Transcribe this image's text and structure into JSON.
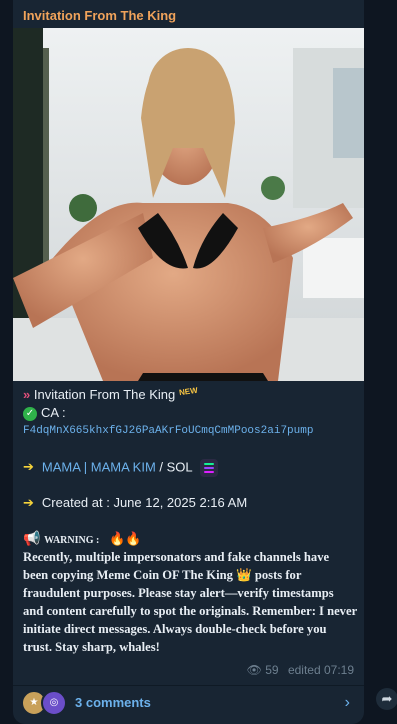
{
  "post": {
    "channel_title": "Invitation From The King",
    "headline_prefix": "»",
    "headline": "Invitation From The King",
    "new_badge": "NEW",
    "ca_label": "CA :",
    "ca_value": "F4dqMnX665khxfGJ26PaAKrFoUCmqCmMPoos2ai7pump",
    "arrow": "➔",
    "coin_link": "MAMA | MAMA KIM",
    "coin_sep": " / SOL",
    "created": "Created at : June 12, 2025 2:16 AM",
    "warning_label": "WARNING :",
    "warning_text": "Recently, multiple impersonators and fake channels have been copying Meme Coin OF The King 👑 posts for fraudulent purposes. Please stay alert—verify timestamps and content carefully to spot the originals. Remember: I never initiate direct messages. Always double-check before you trust. Stay sharp, whales!",
    "views": "59",
    "edited": "edited 07:19"
  },
  "comments": {
    "label": "3 comments"
  },
  "icons": {
    "check": "check-circle-icon",
    "megaphone": "megaphone-icon",
    "eye": "eye-icon",
    "share": "share-icon",
    "chevron": "chevron-right-icon"
  },
  "colors": {
    "background": "#0e1621",
    "bubble": "#182533",
    "channel_title": "#f0a35b",
    "link": "#6cb1eb",
    "text": "#e8eef4"
  }
}
